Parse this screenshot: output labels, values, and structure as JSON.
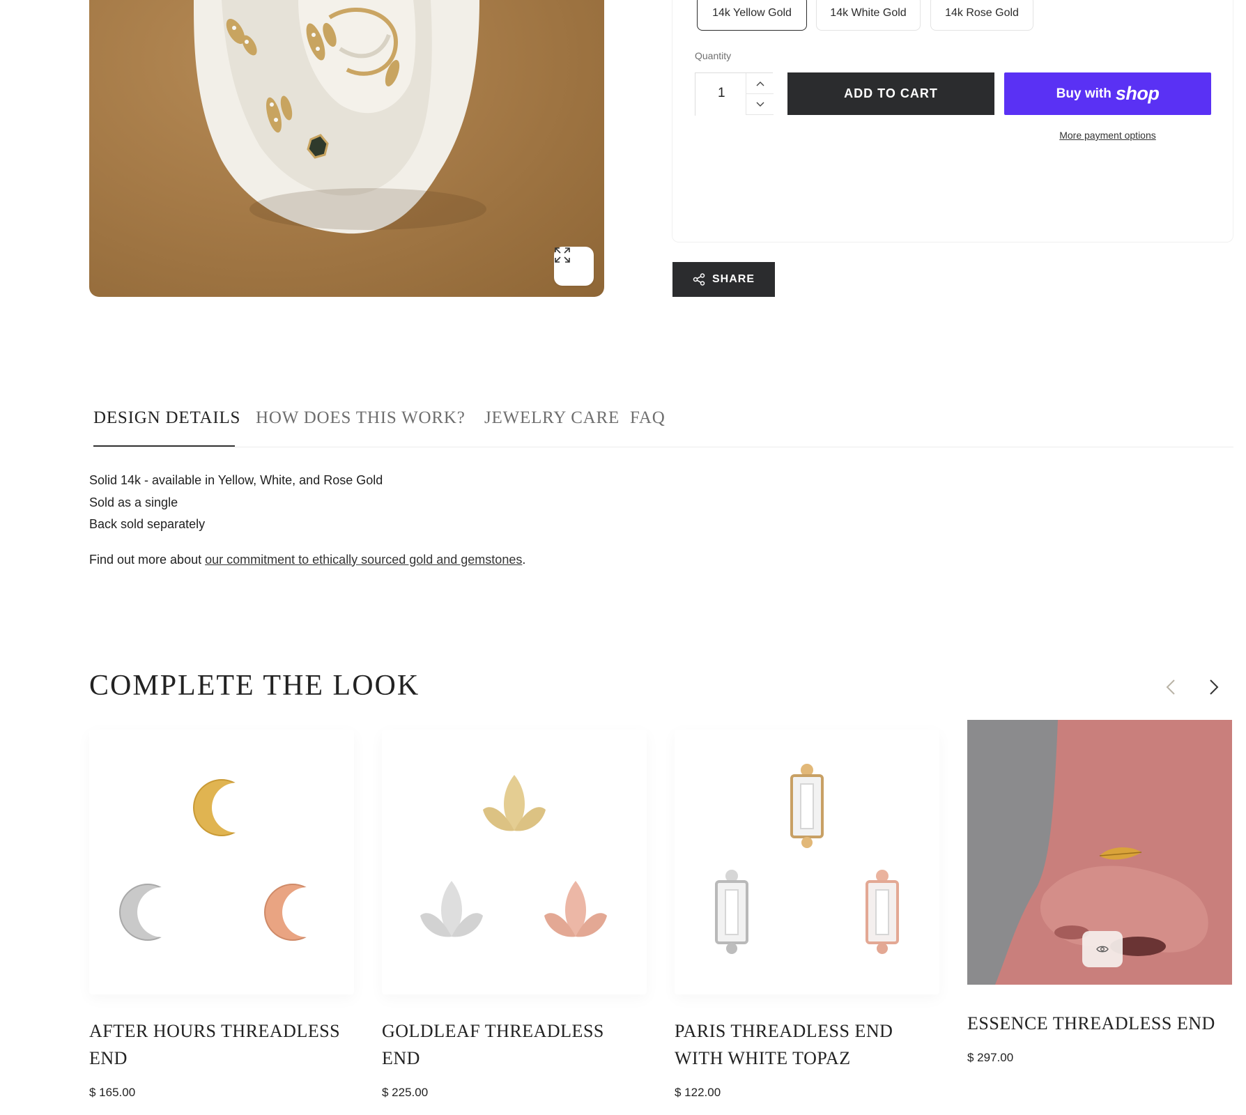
{
  "product": {
    "variants": [
      {
        "label": "14k Yellow Gold",
        "selected": true
      },
      {
        "label": "14k White Gold",
        "selected": false
      },
      {
        "label": "14k Rose Gold",
        "selected": false
      }
    ],
    "quantity_label": "Quantity",
    "quantity_value": "1",
    "add_to_cart_label": "ADD TO CART",
    "shop_pay": {
      "prefix": "Buy with",
      "brand": "shop"
    },
    "more_payment_label": "More payment options",
    "share_label": "SHARE"
  },
  "tabs": [
    {
      "label": "DESIGN DETAILS",
      "active": true
    },
    {
      "label": "HOW DOES THIS WORK?",
      "active": false
    },
    {
      "label": "JEWELRY CARE",
      "active": false
    },
    {
      "label": "FAQ",
      "active": false
    }
  ],
  "details": {
    "lines": [
      "Solid 14k - available in Yellow, White, and Rose Gold",
      "Sold as a single",
      "Back sold separately"
    ],
    "more_prefix": "Find out more about ",
    "more_link": "our commitment to ethically sourced gold and gemstones",
    "more_suffix": "."
  },
  "complete_the_look": {
    "title": "COMPLETE THE LOOK",
    "products": [
      {
        "name": "AFTER HOURS THREADLESS END",
        "price": "$ 165.00",
        "image": "moon-ends"
      },
      {
        "name": "GOLDLEAF THREADLESS END",
        "price": "$ 225.00",
        "image": "leaf-ends"
      },
      {
        "name": "PARIS THREADLESS END WITH WHITE TOPAZ",
        "price": "$ 122.00",
        "image": "baguette-ends"
      },
      {
        "name": "ESSENCE THREADLESS END",
        "price": "$ 297.00",
        "image": "nose-photo"
      }
    ]
  },
  "icons": [
    "expand-icon",
    "chevron-up-icon",
    "chevron-down-icon",
    "share-icon",
    "chevron-left-icon",
    "chevron-right-icon",
    "eye-icon"
  ],
  "colors": {
    "dark_button": "#2b2c2e",
    "shop_pay": "#5a31f4",
    "gold": "#d9b45a",
    "rose": "#e5a48a",
    "silver": "#c9c9c9"
  }
}
